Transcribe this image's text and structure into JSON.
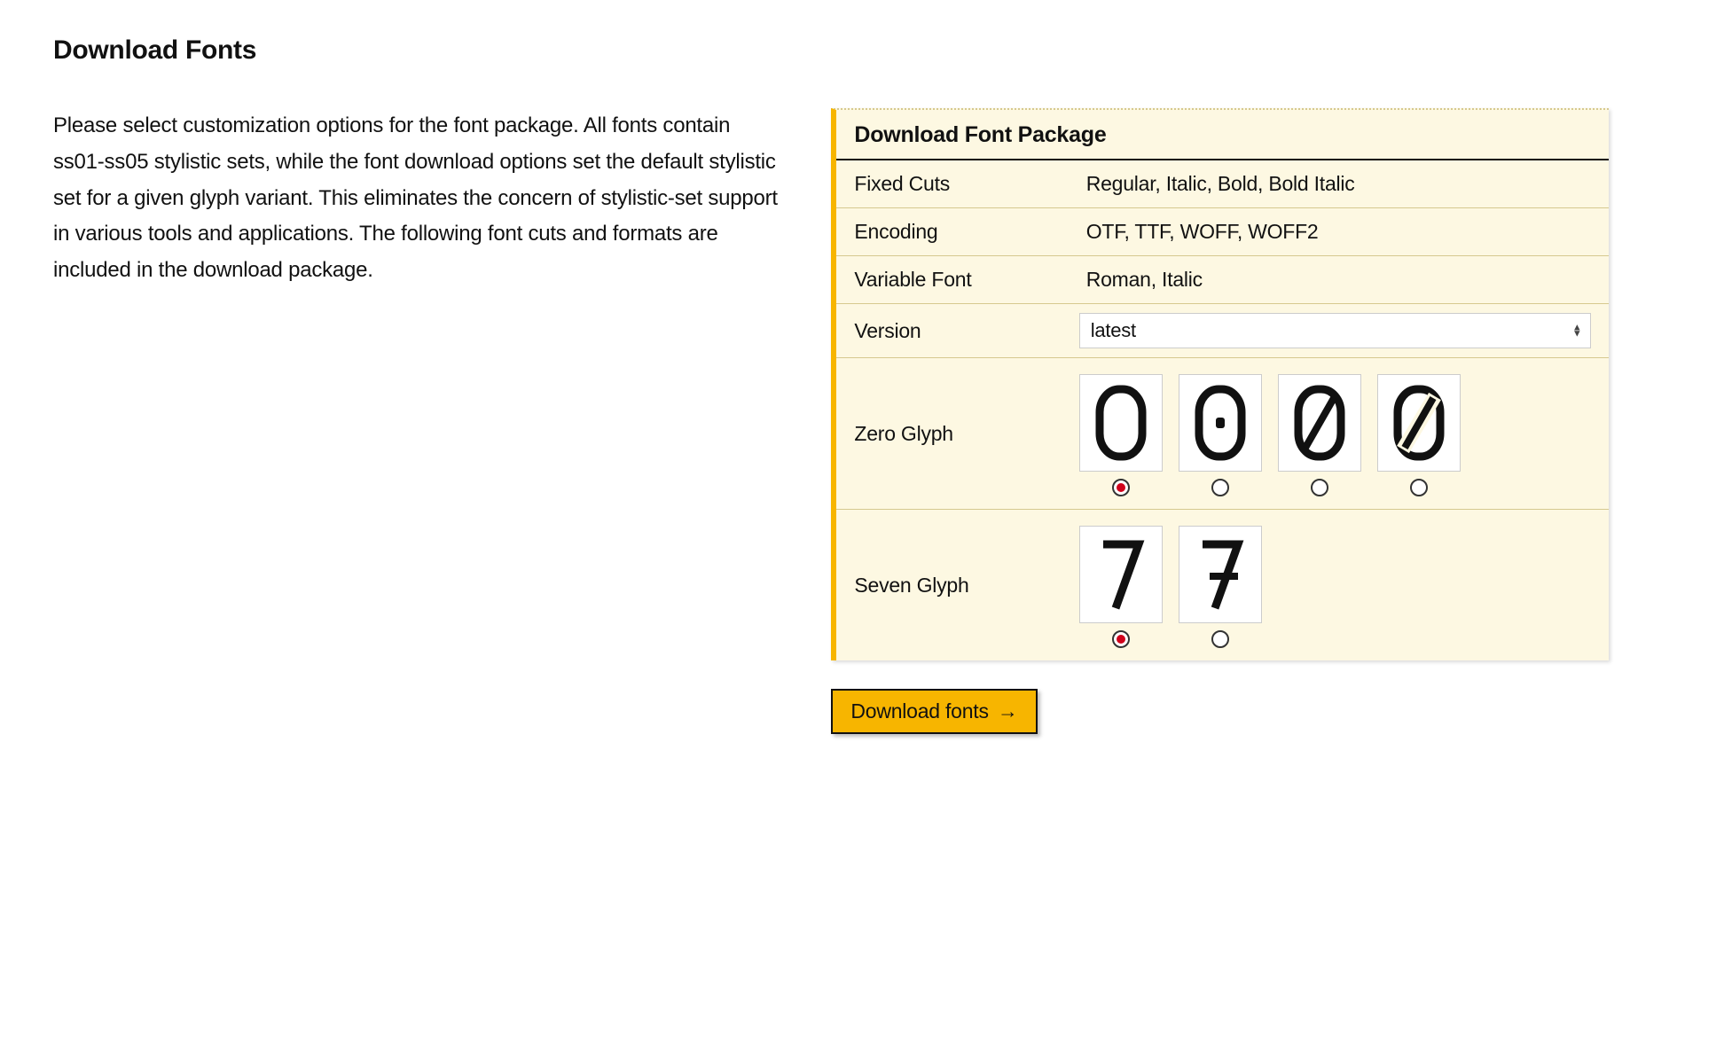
{
  "heading": "Download Fonts",
  "intro": "Please select customization options for the font package. All fonts contain ss01-ss05 stylistic sets, while the font download options set the default stylistic set for a given glyph variant. This eliminates the concern of stylistic-set support in various tools and applications. The following font cuts and formats are included in the download package.",
  "panel": {
    "title": "Download Font Package",
    "rows": {
      "fixed_cuts": {
        "label": "Fixed Cuts",
        "value": "Regular, Italic, Bold, Bold Italic"
      },
      "encoding": {
        "label": "Encoding",
        "value": "OTF, TTF, WOFF, WOFF2"
      },
      "variable": {
        "label": "Variable Font",
        "value": "Roman, Italic"
      },
      "version": {
        "label": "Version",
        "selected": "latest"
      }
    },
    "zero_glyph": {
      "label": "Zero Glyph",
      "selected": 0,
      "options": [
        "plain",
        "dotted",
        "slashed",
        "reverse-slashed"
      ]
    },
    "seven_glyph": {
      "label": "Seven Glyph",
      "selected": 0,
      "options": [
        "plain",
        "crossed"
      ]
    }
  },
  "download_button": "Download fonts",
  "arrow": "→"
}
